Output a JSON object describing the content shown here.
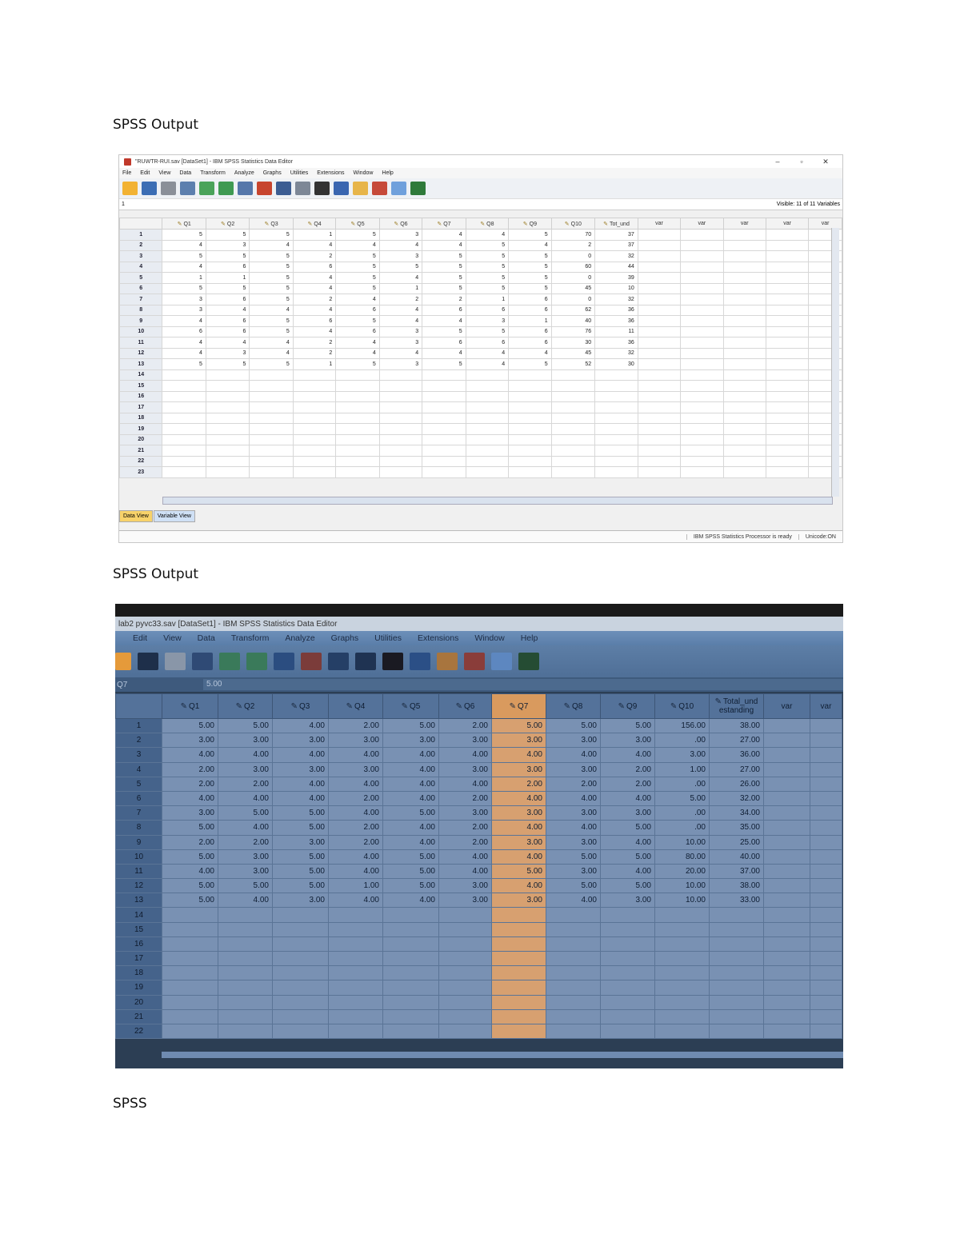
{
  "headings": [
    "SPSS Output",
    "SPSS Output",
    "SPSS"
  ],
  "shot1": {
    "title": "\"RUWTR-RUI.sav [DataSet1] - IBM SPSS Statistics Data Editor",
    "window_controls": [
      "–",
      "▫",
      "✕"
    ],
    "menu": [
      "File",
      "Edit",
      "View",
      "Data",
      "Transform",
      "Analyze",
      "Graphs",
      "Utilities",
      "Extensions",
      "Window",
      "Help"
    ],
    "cell_ref": "1",
    "visible_vars": "Visible: 11 of 11 Variables",
    "columns": [
      "Q1",
      "Q2",
      "Q3",
      "Q4",
      "Q5",
      "Q6",
      "Q7",
      "Q8",
      "Q9",
      "Q10",
      "Tot_und",
      "var",
      "var",
      "var",
      "var",
      "var"
    ],
    "rows": [
      [
        "1",
        "5",
        "5",
        "5",
        "1",
        "5",
        "3",
        "4",
        "4",
        "5",
        "70",
        "37"
      ],
      [
        "2",
        "4",
        "3",
        "4",
        "4",
        "4",
        "4",
        "4",
        "5",
        "4",
        "2",
        "37"
      ],
      [
        "3",
        "5",
        "5",
        "5",
        "2",
        "5",
        "3",
        "5",
        "5",
        "5",
        "0",
        "32"
      ],
      [
        "4",
        "4",
        "6",
        "5",
        "6",
        "5",
        "5",
        "5",
        "5",
        "5",
        "60",
        "44"
      ],
      [
        "5",
        "1",
        "1",
        "5",
        "4",
        "5",
        "4",
        "5",
        "5",
        "5",
        "0",
        "39"
      ],
      [
        "6",
        "5",
        "5",
        "5",
        "4",
        "5",
        "1",
        "5",
        "5",
        "5",
        "45",
        "10"
      ],
      [
        "7",
        "3",
        "6",
        "5",
        "2",
        "4",
        "2",
        "2",
        "1",
        "6",
        "0",
        "32"
      ],
      [
        "8",
        "3",
        "4",
        "4",
        "4",
        "6",
        "4",
        "6",
        "6",
        "6",
        "62",
        "36"
      ],
      [
        "9",
        "4",
        "6",
        "5",
        "6",
        "5",
        "4",
        "4",
        "3",
        "1",
        "40",
        "36"
      ],
      [
        "10",
        "6",
        "6",
        "5",
        "4",
        "6",
        "3",
        "5",
        "5",
        "6",
        "76",
        "11"
      ],
      [
        "11",
        "4",
        "4",
        "4",
        "2",
        "4",
        "3",
        "6",
        "6",
        "6",
        "30",
        "36"
      ],
      [
        "12",
        "4",
        "3",
        "4",
        "2",
        "4",
        "4",
        "4",
        "4",
        "4",
        "45",
        "32"
      ],
      [
        "13",
        "5",
        "5",
        "5",
        "1",
        "5",
        "3",
        "5",
        "4",
        "5",
        "52",
        "30"
      ],
      [
        "14"
      ],
      [
        "15"
      ],
      [
        "16"
      ],
      [
        "17"
      ],
      [
        "18"
      ],
      [
        "19"
      ],
      [
        "20"
      ],
      [
        "21"
      ],
      [
        "22"
      ],
      [
        "23"
      ]
    ],
    "tabs": [
      "Data View",
      "Variable View"
    ],
    "status": [
      "IBM SPSS Statistics Processor is ready",
      "Unicode:ON"
    ]
  },
  "shot2": {
    "title": "lab2 pyvc33.sav [DataSet1] - IBM SPSS Statistics Data Editor",
    "menu": [
      "Edit",
      "View",
      "Data",
      "Transform",
      "Analyze",
      "Graphs",
      "Utilities",
      "Extensions",
      "Window",
      "Help"
    ],
    "cell_ref": "Q7",
    "cell_value": "5.00",
    "columns": [
      "Q1",
      "Q2",
      "Q3",
      "Q4",
      "Q5",
      "Q6",
      "Q7",
      "Q8",
      "Q9",
      "Q10",
      "Total_und estanding",
      "var",
      "var"
    ],
    "rows": [
      [
        "1",
        "5.00",
        "5.00",
        "4.00",
        "2.00",
        "5.00",
        "2.00",
        "5.00",
        "5.00",
        "5.00",
        "156.00",
        "38.00"
      ],
      [
        "2",
        "3.00",
        "3.00",
        "3.00",
        "3.00",
        "3.00",
        "3.00",
        "3.00",
        "3.00",
        "3.00",
        ".00",
        "27.00"
      ],
      [
        "3",
        "4.00",
        "4.00",
        "4.00",
        "4.00",
        "4.00",
        "4.00",
        "4.00",
        "4.00",
        "4.00",
        "3.00",
        "36.00"
      ],
      [
        "4",
        "2.00",
        "3.00",
        "3.00",
        "3.00",
        "4.00",
        "3.00",
        "3.00",
        "3.00",
        "2.00",
        "1.00",
        "27.00"
      ],
      [
        "5",
        "2.00",
        "2.00",
        "4.00",
        "4.00",
        "4.00",
        "4.00",
        "2.00",
        "2.00",
        "2.00",
        ".00",
        "26.00"
      ],
      [
        "6",
        "4.00",
        "4.00",
        "4.00",
        "2.00",
        "4.00",
        "2.00",
        "4.00",
        "4.00",
        "4.00",
        "5.00",
        "32.00"
      ],
      [
        "7",
        "3.00",
        "5.00",
        "5.00",
        "4.00",
        "5.00",
        "3.00",
        "3.00",
        "3.00",
        "3.00",
        ".00",
        "34.00"
      ],
      [
        "8",
        "5.00",
        "4.00",
        "5.00",
        "2.00",
        "4.00",
        "2.00",
        "4.00",
        "4.00",
        "5.00",
        ".00",
        "35.00"
      ],
      [
        "9",
        "2.00",
        "2.00",
        "3.00",
        "2.00",
        "4.00",
        "2.00",
        "3.00",
        "3.00",
        "4.00",
        "10.00",
        "25.00"
      ],
      [
        "10",
        "5.00",
        "3.00",
        "5.00",
        "4.00",
        "5.00",
        "4.00",
        "4.00",
        "5.00",
        "5.00",
        "80.00",
        "40.00"
      ],
      [
        "11",
        "4.00",
        "3.00",
        "5.00",
        "4.00",
        "5.00",
        "4.00",
        "5.00",
        "3.00",
        "4.00",
        "20.00",
        "37.00"
      ],
      [
        "12",
        "5.00",
        "5.00",
        "5.00",
        "1.00",
        "5.00",
        "3.00",
        "4.00",
        "5.00",
        "5.00",
        "10.00",
        "38.00"
      ],
      [
        "13",
        "5.00",
        "4.00",
        "3.00",
        "4.00",
        "4.00",
        "3.00",
        "3.00",
        "4.00",
        "3.00",
        "10.00",
        "33.00"
      ],
      [
        "14"
      ],
      [
        "15"
      ],
      [
        "16"
      ],
      [
        "17"
      ],
      [
        "18"
      ],
      [
        "19"
      ],
      [
        "20"
      ],
      [
        "21"
      ],
      [
        "22"
      ]
    ]
  }
}
